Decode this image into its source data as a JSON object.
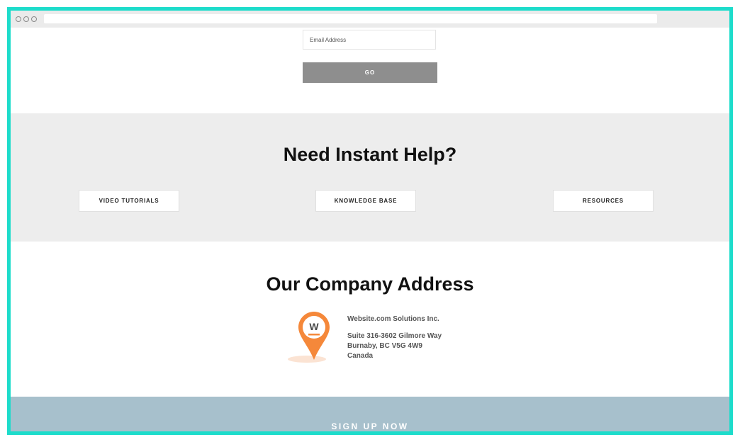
{
  "form": {
    "email_placeholder": "Email Address",
    "go_label": "GO"
  },
  "help": {
    "title": "Need Instant Help?",
    "buttons": [
      {
        "label": "VIDEO TUTORIALS"
      },
      {
        "label": "KNOWLEDGE BASE"
      },
      {
        "label": "RESOURCES"
      }
    ]
  },
  "address": {
    "title": "Our Company Address",
    "company": "Website.com Solutions Inc.",
    "line1": "Suite 316-3602 Gilmore Way",
    "line2": "Burnaby, BC V5G 4W9",
    "line3": "Canada",
    "logo_letter": "W",
    "pin_color": "#f5883a"
  },
  "footer": {
    "signup_label": "SIGN UP NOW"
  },
  "colors": {
    "frame": "#1ddccb",
    "go_button": "#8e8e8e",
    "help_bg": "#ededed",
    "footer_bg": "#a7c0cc"
  }
}
